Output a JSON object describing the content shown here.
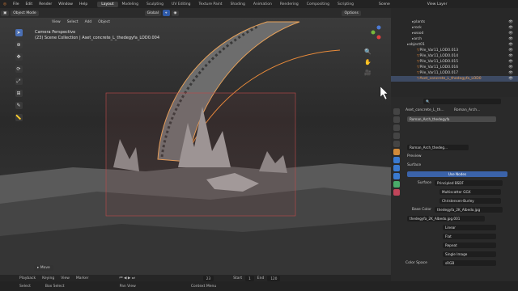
{
  "menubar": {
    "items": [
      "File",
      "Edit",
      "Render",
      "Window",
      "Help"
    ],
    "workspaces": [
      "Layout",
      "Modeling",
      "Sculpting",
      "UV Editing",
      "Texture Paint",
      "Shading",
      "Animation",
      "Rendering",
      "Compositing",
      "Scripting"
    ],
    "active_workspace": "Layout",
    "scene": "Scene",
    "view_layer": "View Layer"
  },
  "viewport": {
    "mode": "Object Mode",
    "menus": [
      "View",
      "Select",
      "Add",
      "Object"
    ],
    "orientation": "Global",
    "options": "Options",
    "camera_label": "Camera Perspective",
    "collection_label": "(23) Scene Collection | Aset_concrete_L_thedegyfa_LOD0.004",
    "last_op": "Move"
  },
  "outliner": {
    "items": [
      {
        "label": "plants",
        "sel": false,
        "indent": 1
      },
      {
        "label": "rock",
        "sel": false,
        "indent": 1
      },
      {
        "label": "wood",
        "sel": false,
        "indent": 1
      },
      {
        "label": "arch",
        "sel": false,
        "indent": 1
      },
      {
        "label": "object01",
        "sel": false,
        "indent": 0
      },
      {
        "label": "Pile_Var11_LOD0.013",
        "sel": false,
        "indent": 2
      },
      {
        "label": "Pile_Var11_LOD0.014",
        "sel": false,
        "indent": 2
      },
      {
        "label": "Pile_Var11_LOD0.015",
        "sel": false,
        "indent": 2
      },
      {
        "label": "Pile_Var11_LOD0.016",
        "sel": false,
        "indent": 2
      },
      {
        "label": "Pile_Var11_LOD0.017",
        "sel": false,
        "indent": 2
      },
      {
        "label": "Aset_concrete_L_thedegyfa_LOD0",
        "sel": true,
        "indent": 2
      }
    ]
  },
  "properties": {
    "object_name": "Aset_concrete_L_th...",
    "material_tab": "Roman_Arch...",
    "slot_material": "Roman_Arch_thedegyfa",
    "material_field": "Roman_Arch_thedeg...",
    "preview": "Preview",
    "surface": "Surface",
    "use_nodes": "Use Nodes",
    "surface_label": "Surface",
    "surface_value": "Principled BSDF",
    "multiscatter": "Multiscatter GGX",
    "christensen": "Christensen-Burley",
    "base_color_label": "Base Color",
    "base_color_value": "thedegyfa_2K_Albedo.jpg",
    "image_name": "thedegyfa_2K_Albedo.jpg.001",
    "linear": "Linear",
    "flat": "Flat",
    "repeat": "Repeat",
    "single_image": "Single Image",
    "color_space_label": "Color Space",
    "color_space_value": "sRGB"
  },
  "timeline": {
    "items": [
      "Playback",
      "Keying",
      "View",
      "Marker"
    ],
    "current_frame": "23",
    "start_label": "Start",
    "start": "1",
    "end_label": "End",
    "end": "120"
  },
  "statusbar": {
    "items": [
      "Select",
      "Box Select",
      "Pan View",
      "Context Menu"
    ]
  },
  "colors": {
    "accent": "#4a6fb5",
    "selection": "#e98b3a",
    "use_nodes": "#3b63a9"
  }
}
